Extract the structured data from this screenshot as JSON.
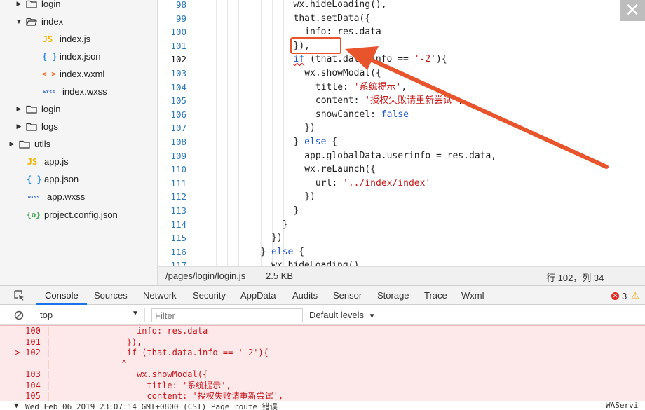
{
  "tree": {
    "items": [
      {
        "label": "login",
        "kind": "folder",
        "arrow": "▶",
        "indent": 2
      },
      {
        "label": "index",
        "kind": "folder-open",
        "arrow": "▼",
        "indent": 2
      },
      {
        "label": "index.js",
        "kind": "js",
        "indent": 3
      },
      {
        "label": "index.json",
        "kind": "json",
        "indent": 3
      },
      {
        "label": "index.wxml",
        "kind": "wxml",
        "indent": 3
      },
      {
        "label": "index.wxss",
        "kind": "wxss",
        "indent": 3
      },
      {
        "label": "login",
        "kind": "folder",
        "arrow": "▶",
        "indent": 2
      },
      {
        "label": "logs",
        "kind": "folder",
        "arrow": "▶",
        "indent": 2
      },
      {
        "label": "utils",
        "kind": "folder",
        "arrow": "▶",
        "indent": 1
      },
      {
        "label": "app.js",
        "kind": "js",
        "indent": 1
      },
      {
        "label": "app.json",
        "kind": "json",
        "indent": 1
      },
      {
        "label": "app.wxss",
        "kind": "wxss",
        "indent": 1
      },
      {
        "label": "project.config.json",
        "kind": "cfg",
        "indent": 1
      }
    ],
    "icons": {
      "js": "JS",
      "json": "{ }",
      "wxml": "< >",
      "wxss": "wxss",
      "cfg": "{o}"
    }
  },
  "editor": {
    "line_numbers": [
      "98",
      "99",
      "100",
      "101",
      "102",
      "103",
      "104",
      "105",
      "106",
      "107",
      "108",
      "109",
      "110",
      "111",
      "112",
      "113",
      "114",
      "115",
      "116",
      "117"
    ],
    "current_line": "102",
    "lines": [
      {
        "indent": 10,
        "tokens": [
          [
            "p",
            "wx.hideLoading(),"
          ]
        ]
      },
      {
        "indent": 10,
        "tokens": [
          [
            "p",
            "that.setData({"
          ]
        ]
      },
      {
        "indent": 12,
        "tokens": [
          [
            "p",
            "info: res.data"
          ]
        ]
      },
      {
        "indent": 10,
        "tokens": [
          [
            "p",
            "}),"
          ]
        ]
      },
      {
        "indent": 10,
        "tokens": [
          [
            "k",
            "if"
          ],
          [
            "p",
            " (that.data.info == "
          ],
          [
            "s",
            "'-2'"
          ],
          [
            "p",
            "){"
          ]
        ]
      },
      {
        "indent": 12,
        "tokens": [
          [
            "p",
            "wx.showModal({"
          ]
        ]
      },
      {
        "indent": 14,
        "tokens": [
          [
            "p",
            "title: "
          ],
          [
            "s",
            "'系统提示'"
          ],
          [
            "p",
            ","
          ]
        ]
      },
      {
        "indent": 14,
        "tokens": [
          [
            "p",
            "content: "
          ],
          [
            "s",
            "'授权失败请重新尝试'"
          ],
          [
            "p",
            ","
          ]
        ]
      },
      {
        "indent": 14,
        "tokens": [
          [
            "p",
            "showCancel: "
          ],
          [
            "k",
            "false"
          ]
        ]
      },
      {
        "indent": 12,
        "tokens": [
          [
            "p",
            "})"
          ]
        ]
      },
      {
        "indent": 10,
        "tokens": [
          [
            "p",
            "} "
          ],
          [
            "k",
            "else"
          ],
          [
            "p",
            " {"
          ]
        ]
      },
      {
        "indent": 12,
        "tokens": [
          [
            "p",
            "app.globalData.userinfo = res.data,"
          ]
        ]
      },
      {
        "indent": 12,
        "tokens": [
          [
            "p",
            "wx.reLaunch({"
          ]
        ]
      },
      {
        "indent": 14,
        "tokens": [
          [
            "p",
            "url: "
          ],
          [
            "s",
            "'../index/index'"
          ]
        ]
      },
      {
        "indent": 12,
        "tokens": [
          [
            "p",
            "})"
          ]
        ]
      },
      {
        "indent": 10,
        "tokens": [
          [
            "p",
            "}"
          ]
        ]
      },
      {
        "indent": 8,
        "tokens": [
          [
            "p",
            "}"
          ]
        ]
      },
      {
        "indent": 6,
        "tokens": [
          [
            "p",
            "})"
          ]
        ]
      },
      {
        "indent": 4,
        "tokens": [
          [
            "p",
            "} "
          ],
          [
            "k",
            "else"
          ],
          [
            "p",
            " {"
          ]
        ]
      },
      {
        "indent": 6,
        "tokens": [
          [
            "p",
            "wx.hideLoading()"
          ]
        ]
      }
    ]
  },
  "statusbar": {
    "path": "/pages/login/login.js",
    "size": "2.5 KB",
    "position": "行 102，列 34"
  },
  "devtools": {
    "tabs": [
      "Console",
      "Sources",
      "Network",
      "Security",
      "AppData",
      "Audits",
      "Sensor",
      "Storage",
      "Trace",
      "Wxml"
    ],
    "active_tab": "Console",
    "error_count": "3",
    "context": "top",
    "filter_placeholder": "Filter",
    "levels": "Default levels"
  },
  "console": {
    "lines": [
      "     100 |                 info: res.data",
      "     101 |               }),",
      "   > 102 |               if (that.data.info == '-2'){",
      "         |              ^",
      "     103 |                 wx.showModal({",
      "     104 |                   title: '系统提示',",
      "     105 |                   content: '授权失败请重新尝试',"
    ]
  },
  "log": {
    "text": "Wed Feb 06 2019 23:07:14 GMT+0800 (CST) Page route 错误",
    "right": "WAServi"
  },
  "colors": {
    "annotation": "#e8542c",
    "error": "#c4161c",
    "keyword": "#1d58c9",
    "string": "#c31a1a"
  }
}
